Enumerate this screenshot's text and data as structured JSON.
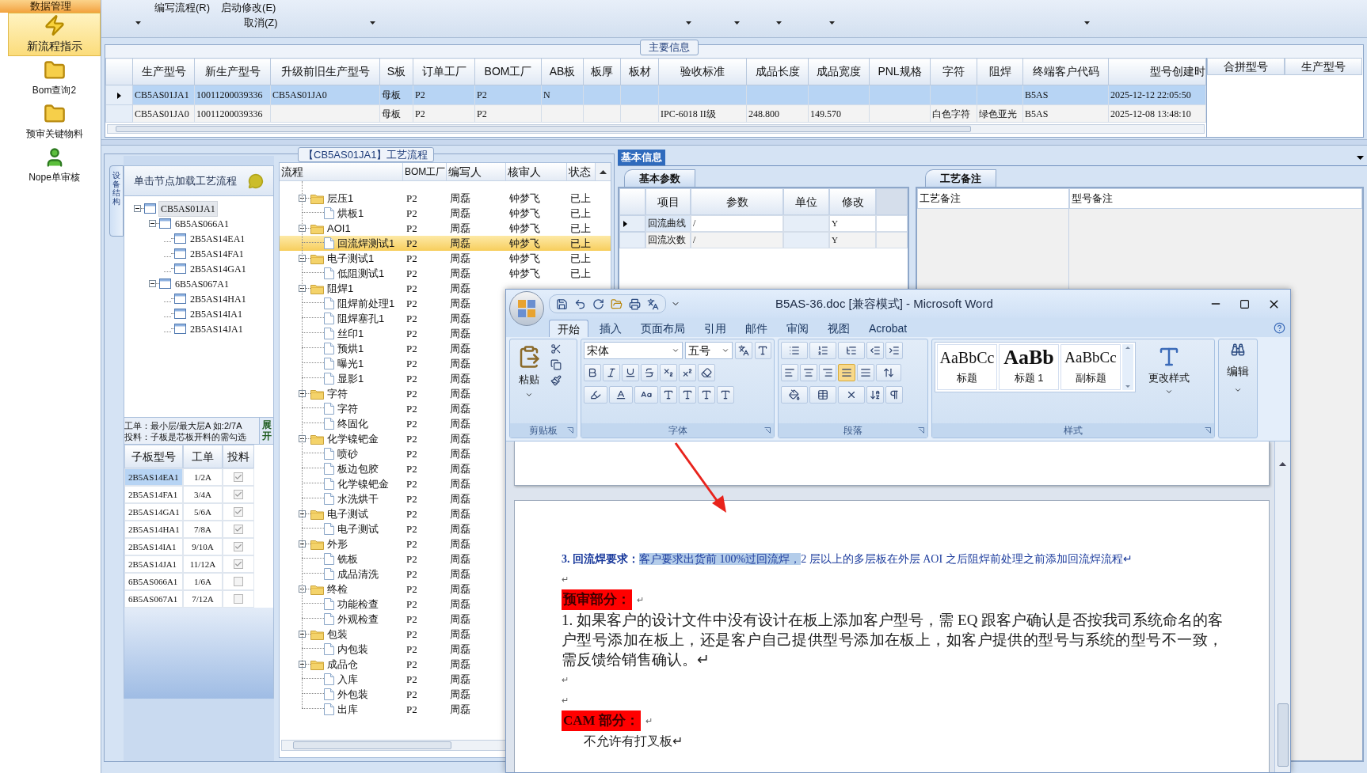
{
  "sidebar": {
    "header": "数据管理",
    "items": [
      {
        "label": "新流程指示",
        "selected": true
      },
      {
        "label": "Bom查询2",
        "selected": false
      },
      {
        "label": "预审关键物料",
        "selected": false
      },
      {
        "label": "Nope单审核",
        "selected": false
      }
    ]
  },
  "toolbar": {
    "menus": [
      "编写流程(R)",
      "启动修改(E)",
      "取消(Z)"
    ]
  },
  "main_info": {
    "title": "主要信息",
    "columns": [
      "生产型号",
      "新生产型号",
      "升级前旧生产型号",
      "S板",
      "订单工厂",
      "BOM工厂",
      "AB板",
      "板厚",
      "板材",
      "验收标准",
      "成品长度",
      "成品宽度",
      "PNL规格",
      "字符",
      "阻焊",
      "终端客户代码",
      "型号创建时"
    ],
    "rows": [
      {
        "selected": true,
        "cells": [
          "CB5AS01JA1",
          "10011200039336",
          "CB5AS01JA0",
          "母板",
          "P2",
          "P2",
          "N",
          null,
          null,
          null,
          null,
          null,
          null,
          null,
          null,
          "B5AS",
          "2025-12-12 22:05:50"
        ]
      },
      {
        "selected": false,
        "cells": [
          "CB5AS01JA0",
          "10011200039336",
          null,
          "母板",
          "P2",
          "P2",
          null,
          null,
          null,
          "IPC-6018 II级",
          "248.800",
          "149.570",
          null,
          "白色字符",
          "绿色亚光",
          "B5AS",
          "2025-12-08 13:48:10"
        ]
      }
    ],
    "side_columns": [
      "合拼型号",
      "生产型号"
    ]
  },
  "structure": {
    "tab": "设备结构",
    "header": "单击节点加载工艺流程",
    "tree": [
      {
        "label": "CB5AS01JA1",
        "selected": true,
        "children": [
          {
            "label": "6B5AS066A1",
            "selected": false,
            "children": [
              {
                "label": "2B5AS14EA1",
                "selected": false
              },
              {
                "label": "2B5AS14FA1",
                "selected": false
              },
              {
                "label": "2B5AS14GA1",
                "selected": false
              }
            ]
          },
          {
            "label": "6B5AS067A1",
            "selected": false,
            "children": [
              {
                "label": "2B5AS14HA1",
                "selected": false
              },
              {
                "label": "2B5AS14IA1",
                "selected": false
              },
              {
                "label": "2B5AS14JA1",
                "selected": false
              }
            ]
          }
        ]
      }
    ],
    "notes": [
      "工单：最小层/最大层A 如:2/7A",
      "投料：子板是芯板开料的需勾选"
    ],
    "expand_button": "展开",
    "table": {
      "columns": [
        "子板型号",
        "工单",
        "投料"
      ],
      "rows": [
        {
          "board": "2B5AS14EA1",
          "order": "1/2A",
          "feed": true,
          "selected": true
        },
        {
          "board": "2B5AS14FA1",
          "order": "3/4A",
          "feed": true,
          "selected": false
        },
        {
          "board": "2B5AS14GA1",
          "order": "5/6A",
          "feed": true,
          "selected": false
        },
        {
          "board": "2B5AS14HA1",
          "order": "7/8A",
          "feed": true,
          "selected": false
        },
        {
          "board": "2B5AS14IA1",
          "order": "9/10A",
          "feed": true,
          "selected": false
        },
        {
          "board": "2B5AS14JA1",
          "order": "11/12A",
          "feed": true,
          "selected": false
        },
        {
          "board": "6B5AS066A1",
          "order": "1/6A",
          "feed": false,
          "selected": false
        },
        {
          "board": "6B5AS067A1",
          "order": "7/12A",
          "feed": false,
          "selected": false
        }
      ]
    }
  },
  "process": {
    "title": "【CB5AS01JA1】工艺流程",
    "columns": [
      "流程",
      "BOM工厂",
      "编写人",
      "核审人",
      "状态"
    ],
    "steps": [
      {
        "name": "层压1",
        "factory": "P2",
        "writer": "周磊",
        "reviewer": "钟梦飞",
        "status": "已上",
        "selected": false,
        "children": [
          {
            "name": "烘板1",
            "factory": "P2",
            "writer": "周磊",
            "reviewer": "钟梦飞",
            "status": "已上",
            "selected": false
          }
        ]
      },
      {
        "name": "AOI1",
        "factory": "P2",
        "writer": "周磊",
        "reviewer": "钟梦飞",
        "status": "已上",
        "selected": false,
        "children": [
          {
            "name": "回流焊测试1",
            "factory": "P2",
            "writer": "周磊",
            "reviewer": "钟梦飞",
            "status": "已上",
            "selected": true
          }
        ]
      },
      {
        "name": "电子测试1",
        "factory": "P2",
        "writer": "周磊",
        "reviewer": "钟梦飞",
        "status": "已上",
        "selected": false,
        "children": [
          {
            "name": "低阻测试1",
            "factory": "P2",
            "writer": "周磊",
            "reviewer": "钟梦飞",
            "status": "已上",
            "selected": false
          }
        ]
      },
      {
        "name": "阻焊1",
        "factory": "P2",
        "writer": "周磊",
        "selected": false,
        "children": [
          {
            "name": "阻焊前处理1",
            "factory": "P2",
            "writer": "周磊",
            "selected": false
          },
          {
            "name": "阻焊塞孔1",
            "factory": "P2",
            "writer": "周磊",
            "selected": false
          },
          {
            "name": "丝印1",
            "factory": "P2",
            "writer": "周磊",
            "selected": false
          },
          {
            "name": "预烘1",
            "factory": "P2",
            "writer": "周磊",
            "selected": false
          },
          {
            "name": "曝光1",
            "factory": "P2",
            "writer": "周磊",
            "selected": false
          },
          {
            "name": "显影1",
            "factory": "P2",
            "writer": "周磊",
            "selected": false
          }
        ]
      },
      {
        "name": "字符",
        "factory": "P2",
        "writer": "周磊",
        "selected": false,
        "children": [
          {
            "name": "字符",
            "factory": "P2",
            "writer": "周磊",
            "selected": false
          },
          {
            "name": "终固化",
            "factory": "P2",
            "writer": "周磊",
            "selected": false
          }
        ]
      },
      {
        "name": "化学镍钯金",
        "factory": "P2",
        "writer": "周磊",
        "selected": false,
        "children": [
          {
            "name": "喷砂",
            "factory": "P2",
            "writer": "周磊",
            "selected": false
          },
          {
            "name": "板边包胶",
            "factory": "P2",
            "writer": "周磊",
            "selected": false
          },
          {
            "name": "化学镍钯金",
            "factory": "P2",
            "writer": "周磊",
            "selected": false
          },
          {
            "name": "水洗烘干",
            "factory": "P2",
            "writer": "周磊",
            "selected": false
          }
        ]
      },
      {
        "name": "电子测试",
        "factory": "P2",
        "writer": "周磊",
        "selected": false,
        "children": [
          {
            "name": "电子测试",
            "factory": "P2",
            "writer": "周磊",
            "selected": false
          }
        ]
      },
      {
        "name": "外形",
        "factory": "P2",
        "writer": "周磊",
        "selected": false,
        "children": [
          {
            "name": "铣板",
            "factory": "P2",
            "writer": "周磊",
            "selected": false
          },
          {
            "name": "成品清洗",
            "factory": "P2",
            "writer": "周磊",
            "selected": false
          }
        ]
      },
      {
        "name": "终检",
        "factory": "P2",
        "writer": "周磊",
        "selected": false,
        "children": [
          {
            "name": "功能检查",
            "factory": "P2",
            "writer": "周磊",
            "selected": false
          },
          {
            "name": "外观检查",
            "factory": "P2",
            "writer": "周磊",
            "selected": false
          }
        ]
      },
      {
        "name": "包装",
        "factory": "P2",
        "writer": "周磊",
        "selected": false,
        "children": [
          {
            "name": "内包装",
            "factory": "P2",
            "writer": "周磊",
            "selected": false
          }
        ]
      },
      {
        "name": "成品仓",
        "factory": "P2",
        "writer": "周磊",
        "selected": false,
        "children": [
          {
            "name": "入库",
            "factory": "P2",
            "writer": "周磊",
            "selected": false
          },
          {
            "name": "外包装",
            "factory": "P2",
            "writer": "周磊",
            "selected": false
          },
          {
            "name": "出库",
            "factory": "P2",
            "writer": "周磊",
            "selected": false
          }
        ]
      }
    ]
  },
  "basic_info": {
    "tab": "基本信息",
    "params": {
      "tab": "基本参数",
      "columns": [
        "项目",
        "参数",
        "单位",
        "修改"
      ],
      "rows": [
        {
          "item": "回流曲线",
          "param": "/",
          "modify": "Y",
          "selected": true
        },
        {
          "item": "回流次数",
          "param": "/",
          "modify": "Y",
          "selected": false
        }
      ]
    },
    "notes": {
      "tab": "工艺备注",
      "columns": [
        "工艺备注",
        "型号备注"
      ]
    }
  },
  "word": {
    "title": "B5AS-36.doc [兼容模式] - Microsoft Word",
    "tabs": [
      {
        "label": "开始",
        "selected": true
      },
      {
        "label": "插入",
        "selected": false
      },
      {
        "label": "页面布局",
        "selected": false
      },
      {
        "label": "引用",
        "selected": false
      },
      {
        "label": "邮件",
        "selected": false
      },
      {
        "label": "审阅",
        "selected": false
      },
      {
        "label": "视图",
        "selected": false
      },
      {
        "label": "Acrobat",
        "selected": false
      }
    ],
    "paste": "粘贴",
    "font": "宋体",
    "size": "五号",
    "groups": [
      "剪贴板",
      "字体",
      "段落",
      "样式"
    ],
    "styles": [
      {
        "kind": "title",
        "preview": "AaBbCc",
        "label": "标题"
      },
      {
        "kind": "heading",
        "preview": "AaBb",
        "label": "标题 1"
      },
      {
        "kind": "subtitle",
        "preview": "AaBbCc",
        "label": "副标题"
      }
    ],
    "change_styles": "更改样式",
    "edit": "编辑",
    "document": [
      {
        "kind": "requirement",
        "label": "3. 回流焊要求：",
        "selection": "客户要求出货前 100%过回流焊，",
        "rest": "2 层以上的多层板在外层 AOI 之后阻焊前处理之前添加回流焊流程↵"
      },
      {
        "kind": "mark",
        "text": "↵"
      },
      {
        "kind": "tag",
        "text": "预审部分：",
        "mark": "↵"
      },
      {
        "kind": "body",
        "text": "1.  如果客户的设计文件中没有设计在板上添加客户型号，需 EQ 跟客户确认是否按我司系统命名的客户型号添加在板上，还是客户自己提供型号添加在板上，如客户提供的型号与系统的型号不一致，需反馈给销售确认。↵"
      },
      {
        "kind": "mark",
        "text": "↵"
      },
      {
        "kind": "mark",
        "text": "↵"
      },
      {
        "kind": "tag",
        "text": "CAM 部分：",
        "mark": "↵"
      },
      {
        "kind": "indented",
        "text": "不允许有打叉板↵"
      }
    ]
  }
}
